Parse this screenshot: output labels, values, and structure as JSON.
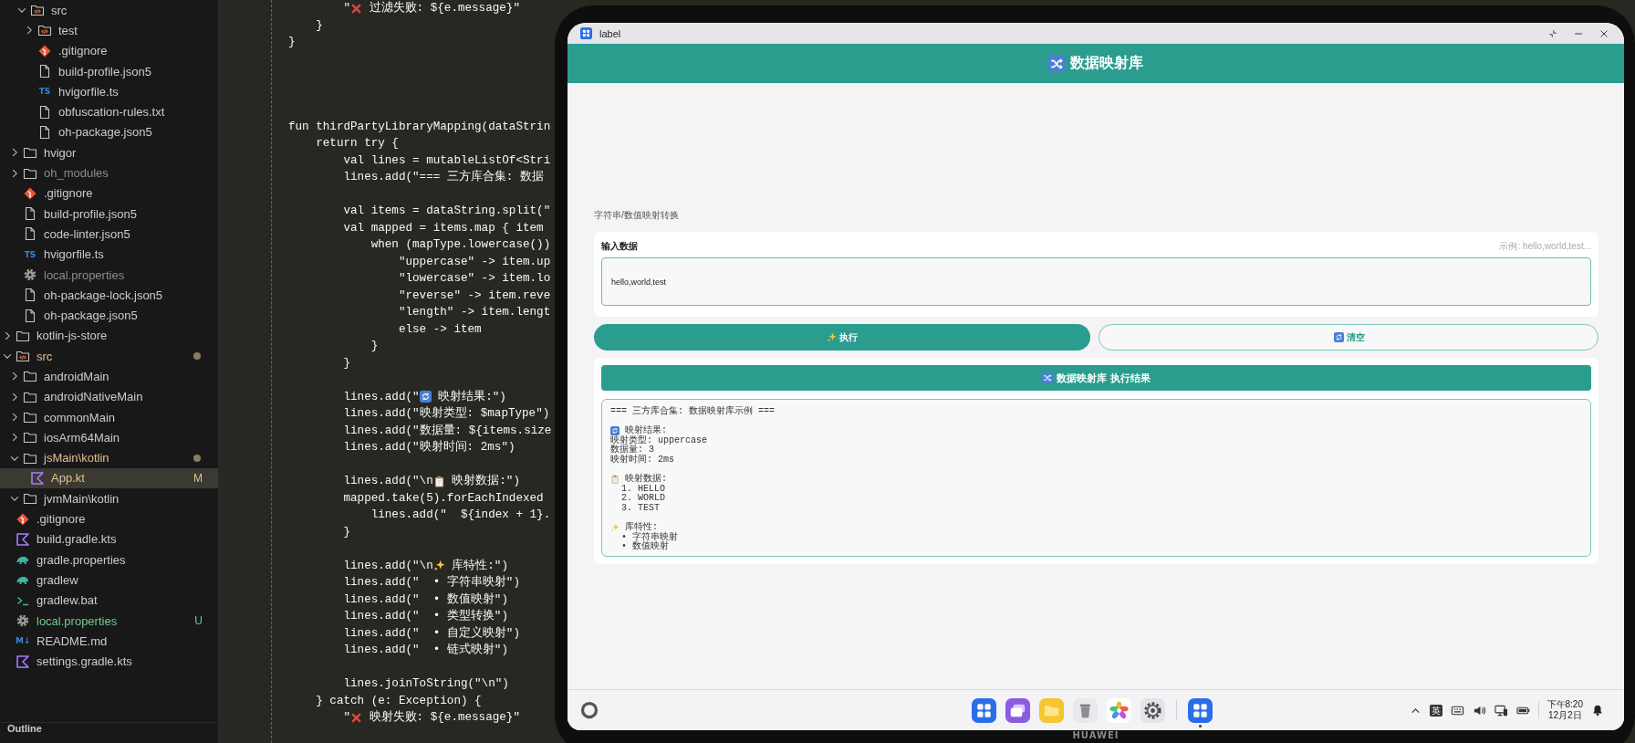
{
  "explorer": {
    "tree": [
      {
        "kind": "offscreen",
        "children": [
          {
            "kind": "offscreen",
            "children": [
              {
                "name": "src",
                "kind": "code-folder",
                "expanded": true,
                "selected": false,
                "ignored": false,
                "modified": false,
                "untracked": false,
                "children": [
                  {
                    "name": "test",
                    "kind": "code-folder",
                    "expanded": false,
                    "selected": false,
                    "ignored": false,
                    "modified": false,
                    "untracked": false
                  },
                  {
                    "name": ".gitignore",
                    "kind": "diamond",
                    "selected": false,
                    "ignored": false,
                    "modified": false,
                    "untracked": false
                  },
                  {
                    "name": "build-profile.json5",
                    "kind": "file",
                    "selected": false,
                    "ignored": false,
                    "modified": false,
                    "untracked": false
                  },
                  {
                    "name": "hvigorfile.ts",
                    "kind": "label",
                    "icon_label": "TS",
                    "selected": false,
                    "ignored": false,
                    "modified": false,
                    "untracked": false
                  },
                  {
                    "name": "obfuscation-rules.txt",
                    "kind": "file",
                    "selected": false,
                    "ignored": false,
                    "modified": false,
                    "untracked": false
                  },
                  {
                    "name": "oh-package.json5",
                    "kind": "file",
                    "selected": false,
                    "ignored": false,
                    "modified": false,
                    "untracked": false
                  }
                ]
              }
            ]
          },
          {
            "name": "hvigor",
            "kind": "folder",
            "expanded": false,
            "selected": false,
            "ignored": false,
            "modified": false,
            "untracked": false
          },
          {
            "name": "oh_modules",
            "kind": "folder",
            "expanded": false,
            "selected": false,
            "ignored": true,
            "modified": false,
            "untracked": false
          },
          {
            "name": ".gitignore",
            "kind": "diamond",
            "selected": false,
            "ignored": false,
            "modified": false,
            "untracked": false
          },
          {
            "name": "build-profile.json5",
            "kind": "file",
            "selected": false,
            "ignored": false,
            "modified": false,
            "untracked": false
          },
          {
            "name": "code-linter.json5",
            "kind": "file",
            "selected": false,
            "ignored": false,
            "modified": false,
            "untracked": false
          },
          {
            "name": "hvigorfile.ts",
            "kind": "label",
            "icon_label": "TS",
            "selected": false,
            "ignored": false,
            "modified": false,
            "untracked": false
          },
          {
            "name": "local.properties",
            "kind": "gear",
            "selected": false,
            "ignored": true,
            "modified": false,
            "untracked": false
          },
          {
            "name": "oh-package-lock.json5",
            "kind": "file",
            "selected": false,
            "ignored": false,
            "modified": false,
            "untracked": false
          },
          {
            "name": "oh-package.json5",
            "kind": "file",
            "selected": false,
            "ignored": false,
            "modified": false,
            "untracked": false
          }
        ]
      },
      {
        "name": "kotlin-js-store",
        "kind": "folder",
        "expanded": false,
        "selected": false,
        "ignored": false,
        "modified": false,
        "untracked": false
      },
      {
        "name": "src",
        "kind": "code-folder",
        "expanded": true,
        "selected": false,
        "ignored": false,
        "modified": true,
        "untracked": false,
        "children": [
          {
            "name": "androidMain",
            "kind": "folder",
            "expanded": false,
            "selected": false,
            "ignored": false,
            "modified": false,
            "untracked": false
          },
          {
            "name": "androidNativeMain",
            "kind": "folder",
            "expanded": false,
            "selected": false,
            "ignored": false,
            "modified": false,
            "untracked": false
          },
          {
            "name": "commonMain",
            "kind": "folder",
            "expanded": false,
            "selected": false,
            "ignored": false,
            "modified": false,
            "untracked": false
          },
          {
            "name": "iosArm64Main",
            "kind": "folder",
            "expanded": false,
            "selected": false,
            "ignored": false,
            "modified": false,
            "untracked": false
          },
          {
            "name": "jsMain\\kotlin",
            "kind": "folder",
            "expanded": true,
            "selected": false,
            "ignored": false,
            "modified": true,
            "untracked": false,
            "children": [
              {
                "name": "App.kt",
                "kind": "notched",
                "badge": "M",
                "selected": true,
                "ignored": false,
                "modified": true,
                "untracked": false
              }
            ]
          },
          {
            "name": "jvmMain\\kotlin",
            "kind": "folder",
            "expanded": true,
            "selected": false,
            "ignored": false,
            "modified": false,
            "untracked": false
          }
        ]
      },
      {
        "name": ".gitignore",
        "kind": "diamond",
        "selected": false,
        "ignored": false,
        "modified": false,
        "untracked": false
      },
      {
        "name": "build.gradle.kts",
        "kind": "notched",
        "selected": false,
        "ignored": false,
        "modified": false,
        "untracked": false
      },
      {
        "name": "gradle.properties",
        "kind": "elephant",
        "selected": false,
        "ignored": false,
        "modified": false,
        "untracked": false
      },
      {
        "name": "gradlew",
        "kind": "elephant",
        "selected": false,
        "ignored": false,
        "modified": false,
        "untracked": false
      },
      {
        "name": "gradlew.bat",
        "kind": "terminal",
        "selected": false,
        "ignored": false,
        "modified": false,
        "untracked": false
      },
      {
        "name": "local.properties",
        "kind": "gear",
        "badge": "U",
        "selected": false,
        "ignored": false,
        "modified": false,
        "untracked": true
      },
      {
        "name": "README.md",
        "kind": "label",
        "icon_label": "M↓",
        "selected": false,
        "ignored": false,
        "modified": false,
        "untracked": false
      },
      {
        "name": "settings.gradle.kts",
        "kind": "notched",
        "selected": false,
        "ignored": false,
        "modified": false,
        "untracked": false
      }
    ],
    "outline_title": "Outline"
  },
  "editor": {
    "lines": [
      {
        "text": "        \"",
        "kind": "cross",
        "after": " 过滤失败: ${e.message}\""
      },
      {
        "text": "    }"
      },
      {
        "text": "}"
      },
      {
        "kind": "blank"
      },
      {
        "kind": "blank"
      },
      {
        "kind": "blank"
      },
      {
        "kind": "blank"
      },
      {
        "text": "fun thirdPartyLibraryMapping(dataStrin"
      },
      {
        "text": "    return try {"
      },
      {
        "text": "        val lines = mutableListOf<Stri"
      },
      {
        "text": "        lines.add(\"=== 三方库合集: 数据"
      },
      {
        "kind": "blank"
      },
      {
        "text": "        val items = dataString.split(\""
      },
      {
        "text": "        val mapped = items.map { item"
      },
      {
        "text": "            when (mapType.lowercase())"
      },
      {
        "text": "                \"uppercase\" -> item.up"
      },
      {
        "text": "                \"lowercase\" -> item.lo"
      },
      {
        "text": "                \"reverse\" -> item.reve"
      },
      {
        "text": "                \"length\" -> item.lengt"
      },
      {
        "text": "                else -> item"
      },
      {
        "text": "            }"
      },
      {
        "text": "        }"
      },
      {
        "kind": "blank"
      },
      {
        "text": "        lines.add(\"",
        "kind": "refresh",
        "after": " 映射结果:\")"
      },
      {
        "text": "        lines.add(\"映射类型: $mapType\")"
      },
      {
        "text": "        lines.add(\"数据量: ${items.size"
      },
      {
        "text": "        lines.add(\"映射时间: 2ms\")"
      },
      {
        "kind": "blank"
      },
      {
        "text": "        lines.add(\"\\n",
        "kind": "clipboard",
        "after": " 映射数据:\")"
      },
      {
        "text": "        mapped.take(5).forEachIndexed"
      },
      {
        "text": "            lines.add(\"  ${index + 1}."
      },
      {
        "text": "        }"
      },
      {
        "kind": "blank"
      },
      {
        "text": "        lines.add(\"\\n",
        "kind": "sparkles",
        "after": " 库特性:\")"
      },
      {
        "text": "        lines.add(\"  • 字符串映射\")"
      },
      {
        "text": "        lines.add(\"  • 数值映射\")"
      },
      {
        "text": "        lines.add(\"  • 类型转换\")"
      },
      {
        "text": "        lines.add(\"  • 自定义映射\")"
      },
      {
        "text": "        lines.add(\"  • 链式映射\")"
      },
      {
        "kind": "blank"
      },
      {
        "text": "        lines.joinToString(\"\\n\")"
      },
      {
        "text": "    } catch (e: Exception) {"
      },
      {
        "text": "        \"",
        "kind": "cross",
        "after": " 映射失败: ${e.message}\""
      }
    ]
  },
  "device": {
    "brand": "HUAWEI",
    "window": {
      "app_title": "label",
      "header_title": "数据映射库",
      "subtitle": "字符串/数值映射转换",
      "input": {
        "label": "输入数据",
        "hint": "示例: hello,world,test...",
        "value": "hello,world,test"
      },
      "buttons": [
        {
          "kind": "execute",
          "label": "执行"
        },
        {
          "kind": "clear",
          "label": "清空"
        }
      ],
      "result": {
        "title": "数据映射库 执行结果",
        "lines": [
          {
            "text": "=== 三方库合集: 数据映射库示例 ==="
          },
          {
            "kind": "blank"
          },
          {
            "kind": "refresh",
            "after": " 映射结果:"
          },
          {
            "text": "映射类型: uppercase"
          },
          {
            "text": "数据量: 3"
          },
          {
            "text": "映射时间: 2ms"
          },
          {
            "kind": "blank"
          },
          {
            "kind": "clipboard",
            "after": " 映射数据:"
          },
          {
            "text": "  1. HELLO"
          },
          {
            "text": "  2. WORLD"
          },
          {
            "text": "  3. TEST"
          },
          {
            "kind": "blank"
          },
          {
            "kind": "sparkles",
            "after": " 库特性:"
          },
          {
            "text": "  • 字符串映射"
          },
          {
            "text": "  • 数值映射"
          }
        ]
      }
    },
    "taskbar": {
      "dock": [
        {
          "kind": "grid",
          "running": false
        },
        {
          "kind": "windows",
          "running": false
        },
        {
          "kind": "folder",
          "running": false
        },
        {
          "kind": "trash",
          "running": false
        },
        {
          "kind": "flower",
          "running": false
        },
        {
          "kind": "gear",
          "running": false
        },
        {
          "kind": "grid",
          "running": true
        }
      ],
      "ime": "英",
      "time": "下午8:20",
      "date": "12月2日"
    }
  }
}
